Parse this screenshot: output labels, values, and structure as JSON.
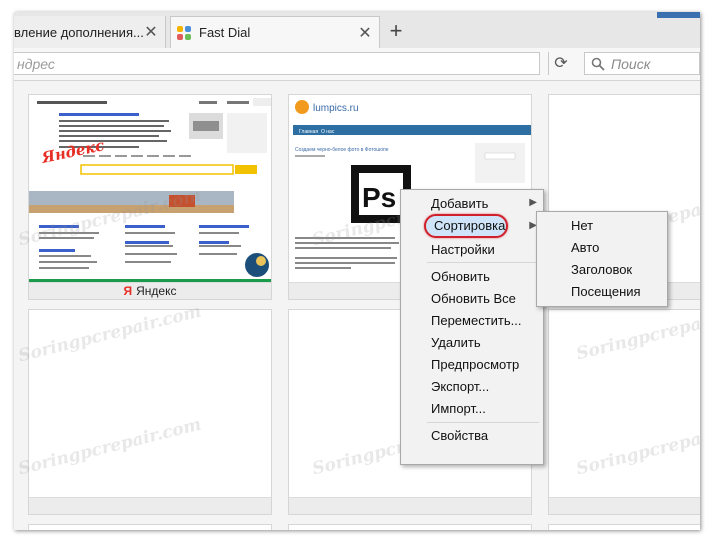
{
  "tabs": [
    {
      "label": "вление дополнения...",
      "active": false
    },
    {
      "label": "Fast Dial",
      "active": true
    }
  ],
  "address_placeholder": "ндрес",
  "search_placeholder": "Поиск",
  "tiles": [
    {
      "label": "Яндекс",
      "badge": "Я"
    },
    {
      "label": ""
    }
  ],
  "thumb_yandex": {
    "header": "Сделать стартовой   Санкт-Петербург",
    "news_title": "Новости  в Санкт-Петербурге",
    "logo": "Яндекс",
    "search_button": "Найти",
    "weather": "Погода  +21 °C",
    "traffic": "Пробки  3 балла",
    "map": "Карта Санкт-Петербурга",
    "tv": "Телепрограмма",
    "poster": "Афиша",
    "region_news": "Посещаемые"
  },
  "thumb_lumpics": {
    "site": "lumpics.ru",
    "nav": [
      "Главная",
      "О нас"
    ],
    "article": "Создаем черно-белое фото в Фотошопе",
    "ps": "Ps"
  },
  "context_menu": {
    "items": [
      "Добавить",
      "Сортировка",
      "Настройки",
      "Обновить",
      "Обновить Все",
      "Переместить...",
      "Удалить",
      "Предпросмотр",
      "Экспорт...",
      "Импорт...",
      "Свойства"
    ]
  },
  "submenu": {
    "items": [
      "Нет",
      "Авто",
      "Заголовок",
      "Посещения"
    ]
  },
  "watermark": "Soringpcrepair.com",
  "colors": {
    "accent": "#d0202b",
    "yandex": "#e62e24",
    "highlight": "#cfe4f8"
  }
}
